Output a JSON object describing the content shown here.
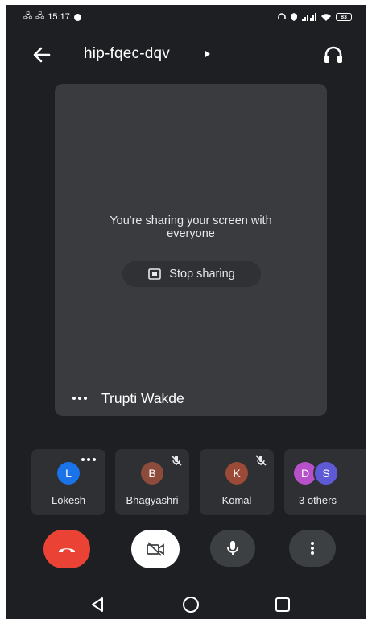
{
  "status_bar": {
    "time": "15:17",
    "battery": "83"
  },
  "meeting": {
    "code": "hip-fqec-dqv"
  },
  "main_tile": {
    "share_line1": "You're sharing your screen with",
    "share_line2": "everyone",
    "stop_sharing_label": "Stop sharing",
    "presenter_name": "Trupti Wakde"
  },
  "participants": [
    {
      "initial": "L",
      "name": "Lokesh",
      "avatar_color": "#1a73e8"
    },
    {
      "initial": "B",
      "name": "Bhagyashri",
      "avatar_color": "#8d4b3c"
    },
    {
      "initial": "K",
      "name": "Komal",
      "avatar_color": "#9a4a36"
    },
    {
      "initials": [
        "D",
        "S"
      ],
      "name": "3 others",
      "avatar_colors": [
        "#b651c9",
        "#5e5ad6"
      ]
    }
  ],
  "colors": {
    "background": "#1e1f22",
    "tile": "#3a3b3f",
    "end_call": "#ea4335",
    "camera_off_button": "#ffffff",
    "control_button": "#3c4043"
  },
  "icons": {
    "back": "arrow-left-icon",
    "audio": "headphones-icon",
    "end_call": "phone-hangup-icon",
    "camera": "camera-off-icon",
    "mic": "microphone-icon",
    "more": "more-vertical-icon"
  }
}
